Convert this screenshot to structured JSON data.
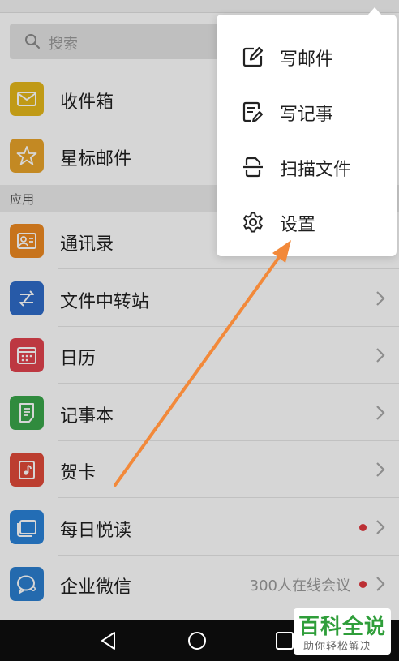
{
  "search": {
    "placeholder": "搜索"
  },
  "mail": {
    "items": [
      {
        "label": "收件箱",
        "icon": "inbox-icon",
        "color": "#e5b81b"
      },
      {
        "label": "星标邮件",
        "icon": "star-icon",
        "color": "#e9a42a"
      }
    ]
  },
  "apps": {
    "section_label": "应用",
    "items": [
      {
        "label": "通讯录",
        "icon": "contacts-icon",
        "color": "#ee8a22"
      },
      {
        "label": "文件中转站",
        "icon": "file-transfer-icon",
        "color": "#2f6cc9"
      },
      {
        "label": "日历",
        "icon": "calendar-icon",
        "color": "#e2434e"
      },
      {
        "label": "记事本",
        "icon": "notepad-icon",
        "color": "#3aa64a"
      },
      {
        "label": "贺卡",
        "icon": "greeting-card-icon",
        "color": "#e14a3a"
      },
      {
        "label": "每日悦读",
        "icon": "daily-reading-icon",
        "color": "#2a82d8"
      },
      {
        "label": "企业微信",
        "icon": "wecom-icon",
        "color": "#2c7fd0",
        "extra": "300人在线会议"
      }
    ]
  },
  "menu": {
    "items": [
      {
        "label": "写邮件",
        "icon": "compose-icon"
      },
      {
        "label": "写记事",
        "icon": "write-note-icon"
      },
      {
        "label": "扫描文件",
        "icon": "scan-document-icon"
      },
      {
        "label": "设置",
        "icon": "settings-gear-icon"
      }
    ]
  },
  "annotation": {
    "arrow_color": "#f2893a"
  },
  "watermark": {
    "title": "百科全说",
    "subtitle": "助你轻松解决"
  }
}
